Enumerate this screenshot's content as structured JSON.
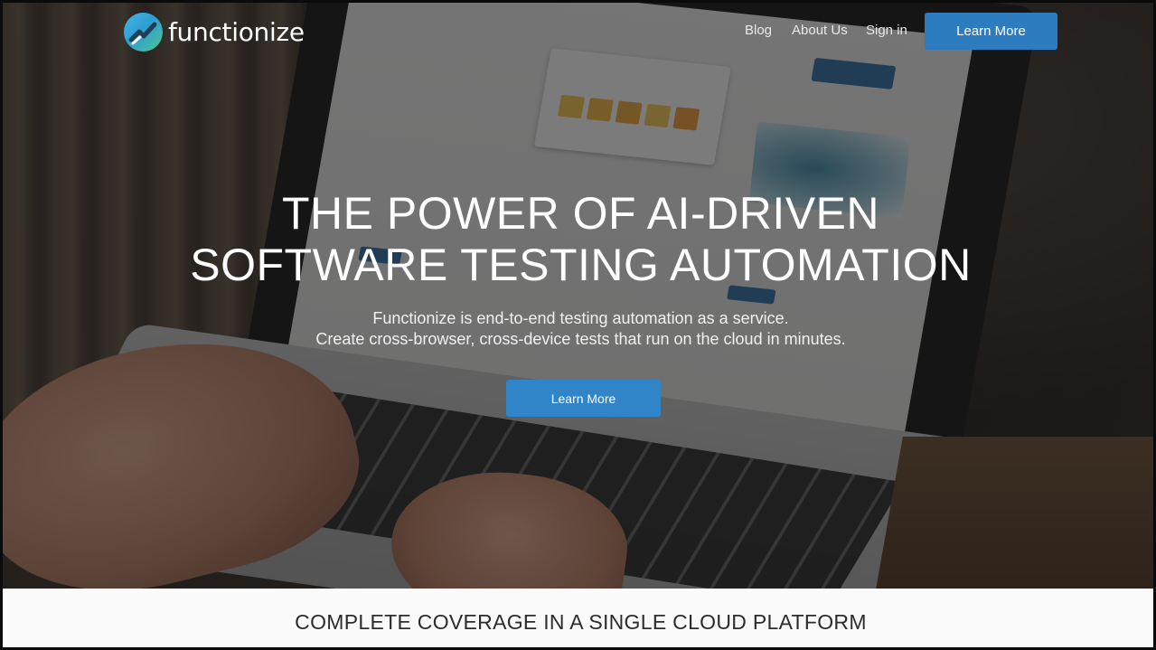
{
  "brand": {
    "name": "functionize",
    "logo_colors": [
      "#41b6e6",
      "#4cc58f"
    ]
  },
  "nav": {
    "links": [
      {
        "label": "Blog"
      },
      {
        "label": "About Us"
      },
      {
        "label": "Sign in"
      }
    ],
    "cta_label": "Learn More"
  },
  "hero": {
    "title_lines": [
      "THE POWER OF AI-DRIVEN",
      "SOFTWARE TESTING AUTOMATION"
    ],
    "subtitle_lines": [
      "Functionize is end-to-end testing automation as a service.",
      "Create cross-browser, cross-device tests that run on the cloud in minutes."
    ],
    "cta_label": "Learn More",
    "background_image": "person typing on laptop showing Functionize website"
  },
  "section": {
    "heading": "COMPLETE COVERAGE IN A SINGLE CLOUD PLATFORM"
  },
  "colors": {
    "accent": "#2d7cc0",
    "band_background": "#fafafa"
  }
}
